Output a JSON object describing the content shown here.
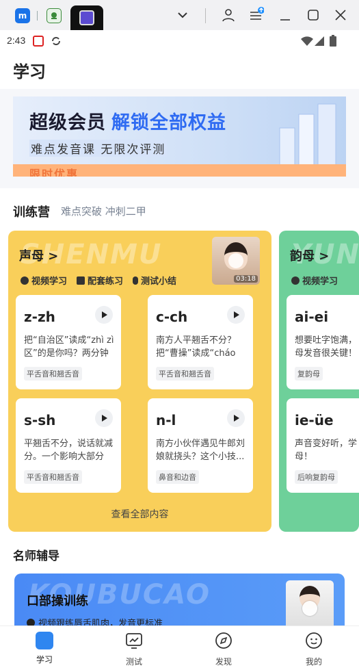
{
  "status": {
    "time": "2:43"
  },
  "header": {
    "title": "学习"
  },
  "banner": {
    "title": "超级会员",
    "title_accent": "解锁全部权益",
    "subtitle": "难点发音课 无限次评测",
    "strip": "限时优惠"
  },
  "camp_section": {
    "title": "训练营",
    "subtitle": "难点突破 冲刺二甲"
  },
  "camps": [
    {
      "ghost": "SHENMU",
      "title": "声母 >",
      "meta": [
        "视频学习",
        "配套练习",
        "测试小结"
      ],
      "video_duration": "03:18",
      "items": [
        {
          "title": "z-zh",
          "desc": "把“自治区”读成“zhì zì区”的是你吗？两分钟帮你...",
          "tag": "平舌音和翘舌音"
        },
        {
          "title": "c-ch",
          "desc": "南方人平翘舌不分？把“曹操”读成“cháo cā...",
          "tag": "平舌音和翘舌音"
        },
        {
          "title": "s-sh",
          "desc": "平翘舌不分，说话就减分。一个影响大部分考...",
          "tag": "平舌音和翘舌音"
        },
        {
          "title": "n-l",
          "desc": "南方小伙伴遇见牛郎刘娘就挠头？这个小技...",
          "tag": "鼻音和边音"
        }
      ],
      "see_all": "查看全部内容"
    },
    {
      "ghost": "YUN",
      "title": "韵母 >",
      "meta": [
        "视频学习"
      ],
      "items": [
        {
          "title": "ai-ei",
          "desc": "想要吐字饱满，母发音很关键！",
          "tag": "复韵母"
        },
        {
          "title": "ie-üe",
          "desc": "声音变好听，学母！",
          "tag": "后响复韵母"
        }
      ]
    }
  ],
  "teacher_section": {
    "title": "名师辅导"
  },
  "coach": {
    "ghost": "KOUBUCAO",
    "title": "口部操训练",
    "subtitle": "视频跟练唇舌肌肉，发音更标准"
  },
  "nav": [
    {
      "label": "学习",
      "icon": "study-tv-icon",
      "active": true
    },
    {
      "label": "测试",
      "icon": "test-chart-icon",
      "active": false
    },
    {
      "label": "发现",
      "icon": "compass-icon",
      "active": false
    },
    {
      "label": "我的",
      "icon": "profile-face-icon",
      "active": false
    }
  ],
  "colors": {
    "accent": "#2f6bf2",
    "camp_yellow": "#f9cf5a",
    "camp_green": "#6ed09a",
    "coach_blue": "#4a8af5"
  }
}
